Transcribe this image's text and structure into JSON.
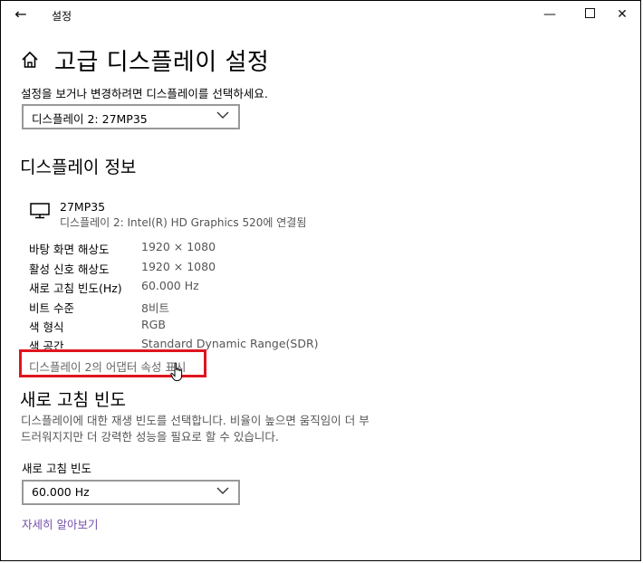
{
  "window": {
    "back_glyph": "←",
    "title": "설정",
    "minimize_glyph": "—",
    "close_glyph": "✕"
  },
  "page": {
    "title": "고급 디스플레이 설정",
    "select_prompt": "설정을 보거나 변경하려면 디스플레이를 선택하세요.",
    "display_select": "디스플레이 2: 27MP35"
  },
  "display_info": {
    "heading": "디스플레이 정보",
    "monitor_name": "27MP35",
    "monitor_connection": "디스플레이 2: Intel(R) HD Graphics 520에 연결됨",
    "rows": [
      {
        "label": "바탕 화면 해상도",
        "value": "1920 × 1080"
      },
      {
        "label": "활성 신호 해상도",
        "value": "1920 × 1080"
      },
      {
        "label": "새로 고침 빈도(Hz)",
        "value": "60.000 Hz"
      },
      {
        "label": "비트 수준",
        "value": "8비트"
      },
      {
        "label": "색 형식",
        "value": "RGB"
      },
      {
        "label": "색 공간",
        "value": "Standard Dynamic Range(SDR)"
      }
    ],
    "adapter_link": "디스플레이 2의 어댑터 속성 표시"
  },
  "refresh": {
    "heading": "새로 고침 빈도",
    "description": "디스플레이에 대한 재생 빈도를 선택합니다. 비율이 높으면 움직임이 더 부드러워지지만 더 강력한 성능을 필요로 할 수 있습니다.",
    "label": "새로 고침 빈도",
    "select_value": "60.000 Hz",
    "learn_more": "자세히 알아보기"
  },
  "colors": {
    "highlight": "#e0141e",
    "link": "#744da9"
  },
  "icons": [
    "back-arrow-icon",
    "home-icon",
    "monitor-icon",
    "chevron-down-icon",
    "hand-cursor-icon"
  ]
}
